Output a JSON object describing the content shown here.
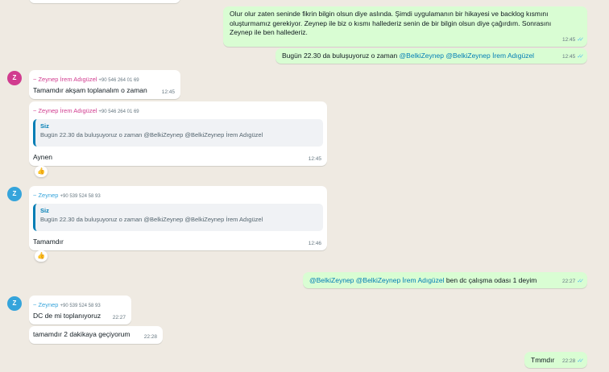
{
  "colors": {
    "chat_background": "#efeae2",
    "incoming_bubble": "#ffffff",
    "outgoing_bubble": "#d9fdd3",
    "mention": "#027eb5",
    "read_ticks": "#53bdeb",
    "sender_zeynep_irem": "#d13c8f",
    "sender_zeynep": "#35a4db"
  },
  "messages": {
    "m1": {
      "text_lines": [
        "Olur olur zaten seninde fikrin bilgin olsun diye aslında. Şimdi uygulamanın bir hikayesi ve backlog kısmını",
        "oluşturmamız gerekiyor. Zeynep ile biz o kısmı hallederiz senin de bir bilgin olsun diye çağırdım. Sonrasını",
        "Zeynep ile ben hallederiz."
      ],
      "time": "12:45",
      "status_icon": "double-check-read-icon"
    },
    "m2": {
      "prefix": "Bugün 22.30 da buluşuyoruz o zaman ",
      "mention1": "@BelkiZeynep",
      "mention2": "@BelkiZeynep İrem Adıgüzel",
      "time": "12:45",
      "status_icon": "double-check-read-icon"
    },
    "m3": {
      "avatar_letter": "Z",
      "sender": "~ Zeynep İrem Adıgüzel",
      "phone": "+90 546 264 01 69",
      "text": "Tamamdır akşam toplanalım o zaman",
      "time": "12:45"
    },
    "m4": {
      "sender": "~ Zeynep İrem Adıgüzel",
      "phone": "+90 546 264 01 69",
      "quote_author": "Siz",
      "quote_text": "Bugün 22.30 da buluşuyoruz o zaman @BelkiZeynep @BelkiZeynep İrem Adıgüzel",
      "text": "Aynen",
      "time": "12:45",
      "reaction": "👍"
    },
    "m5": {
      "avatar_letter": "Z",
      "sender": "~ Zeynep",
      "phone": "+90 539 524 58 93",
      "quote_author": "Siz",
      "quote_text": "Bugün 22.30 da buluşuyoruz o zaman @BelkiZeynep @BelkiZeynep İrem Adıgüzel",
      "text": "Tamamdır",
      "time": "12:46",
      "reaction": "👍"
    },
    "m6": {
      "mention1": "@BelkiZeynep",
      "mention2": "@BelkiZeynep İrem Adıgüzel",
      "suffix": " ben dc çalışma odası 1 deyim",
      "time": "22:27",
      "status_icon": "double-check-read-icon"
    },
    "m7": {
      "avatar_letter": "Z",
      "sender": "~ Zeynep",
      "phone": "+90 539 524 58 93",
      "text": "DC de mi toplanıyoruz",
      "time": "22:27"
    },
    "m8": {
      "text": "tamamdır 2 dakikaya geçiyorum",
      "time": "22:28"
    },
    "m9": {
      "text": "Tmmdır",
      "time": "22:28",
      "status_icon": "double-check-read-icon"
    }
  }
}
